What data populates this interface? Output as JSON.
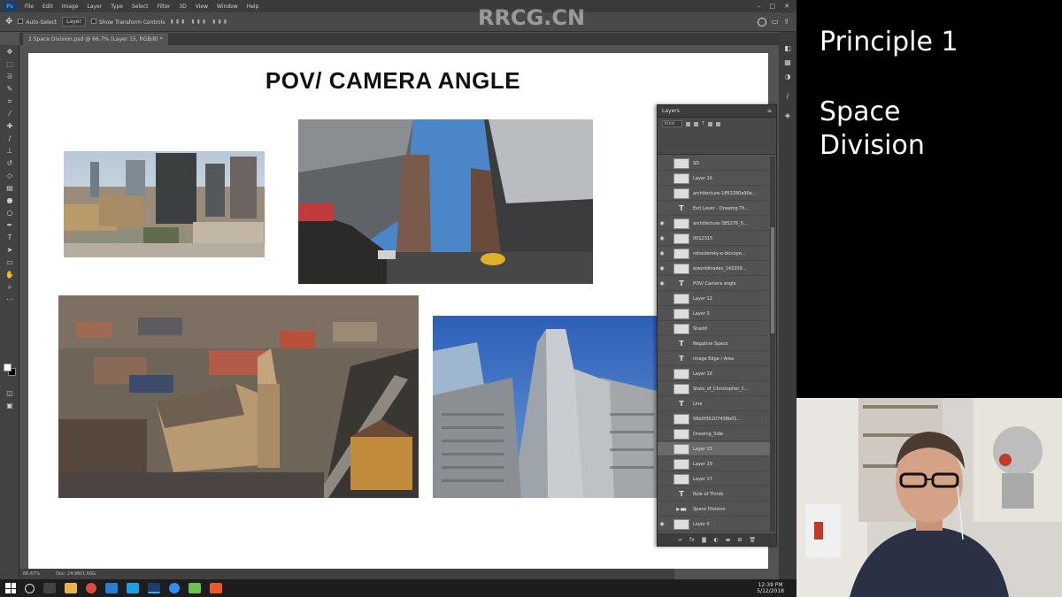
{
  "menubar": {
    "app_badge": "Ps",
    "items": [
      "File",
      "Edit",
      "Image",
      "Layer",
      "Type",
      "Select",
      "Filter",
      "3D",
      "View",
      "Window",
      "Help"
    ]
  },
  "options": {
    "auto_select": "Auto-Select",
    "layer_select": "Layer",
    "transform_controls": "Show Transform Controls"
  },
  "document": {
    "tab_title": "2 Space Division.psd @ 66.7% (Layer 15, RGB/8) *",
    "canvas_title": "POV/ CAMERA ANGLE",
    "zoom": "66.67%",
    "doc_size": "Doc: 24.9M/1.60G"
  },
  "layers_panel": {
    "title": "Layers",
    "filter_kind": "Kind",
    "rows": [
      {
        "name": "SD",
        "type": "img",
        "eye": false
      },
      {
        "name": "Layer 16",
        "type": "img",
        "eye": false
      },
      {
        "name": "architecture-1853280a90e...",
        "type": "img",
        "eye": false
      },
      {
        "name": "Exit Lever - Drawing Th...",
        "type": "text",
        "eye": false
      },
      {
        "name": "architecture-385276_5...",
        "type": "img",
        "eye": true
      },
      {
        "name": "0012315",
        "type": "img",
        "eye": true
      },
      {
        "name": "rohastersky-e-biccoye...",
        "type": "img",
        "eye": true
      },
      {
        "name": "ejworldtrades_143209...",
        "type": "img",
        "eye": true
      },
      {
        "name": "POV/ Camera angle",
        "type": "text",
        "eye": true
      },
      {
        "name": "Layer 12",
        "type": "img",
        "eye": false
      },
      {
        "name": "Layer 3",
        "type": "img",
        "eye": false
      },
      {
        "name": "Shadd",
        "type": "img",
        "eye": false
      },
      {
        "name": "Negative Space",
        "type": "text",
        "eye": false
      },
      {
        "name": "Image Edge / Area",
        "type": "text",
        "eye": false
      },
      {
        "name": "Layer 16",
        "type": "img",
        "eye": false
      },
      {
        "name": "Stata_of_Christopher_C...",
        "type": "img",
        "eye": false
      },
      {
        "name": "Line",
        "type": "text",
        "eye": false
      },
      {
        "name": "58b0f35207438b01...",
        "type": "img",
        "eye": false
      },
      {
        "name": "Drawing_Side",
        "type": "img",
        "eye": false
      },
      {
        "name": "Layer 15",
        "type": "img",
        "eye": false,
        "selected": true
      },
      {
        "name": "Layer 29",
        "type": "img",
        "eye": false
      },
      {
        "name": "Layer 17",
        "type": "img",
        "eye": false
      },
      {
        "name": "Rule of Thirds",
        "type": "text",
        "eye": false
      },
      {
        "name": "Space Division",
        "type": "folder",
        "eye": false
      },
      {
        "name": "Layer 0",
        "type": "img",
        "eye": true
      }
    ]
  },
  "slide": {
    "line1": "Principle 1",
    "line2": "Space",
    "line3": "Division"
  },
  "taskbar": {
    "time": "12:39 PM",
    "date": "5/12/2018"
  },
  "watermark": {
    "text": "RRCG.CN"
  },
  "colors": {
    "ps_bg": "#535353",
    "ps_dark": "#3b3b3b",
    "canvas": "#ffffff",
    "slide_bg": "#000000",
    "accent_ps": "#31a8ff"
  }
}
